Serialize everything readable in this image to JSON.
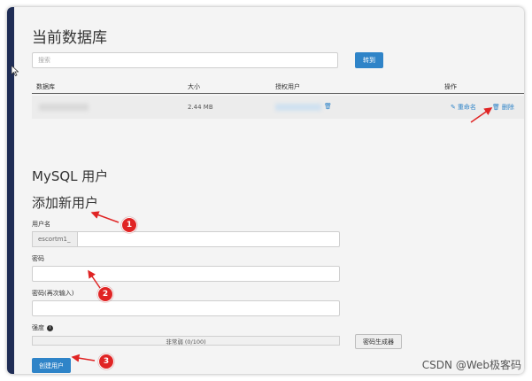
{
  "db": {
    "title": "当前数据库",
    "search_placeholder": "搜索",
    "goto_label": "转到",
    "columns": [
      "数据库",
      "大小",
      "授权用户",
      "操作"
    ],
    "row": {
      "size": "2.44 MB",
      "rename": "重命名",
      "delete": "删除"
    }
  },
  "mysql": {
    "section_title": "MySQL 用户",
    "add_title": "添加新用户",
    "username_label": "用户名",
    "username_prefix": "escortm1_",
    "password_label": "密码",
    "password_again_label": "密码(再次输入)",
    "strength_label": "强度",
    "strength_text": "非常弱 (0/100)",
    "strength_value": 0,
    "generator_label": "密码生成器",
    "create_label": "创建用户"
  },
  "annotations": [
    "1",
    "2",
    "3"
  ],
  "watermark": "CSDN @Web极客码",
  "colors": {
    "accent": "#2f84c8",
    "annotation": "#e02424",
    "sidebar": "#1f2d55"
  }
}
